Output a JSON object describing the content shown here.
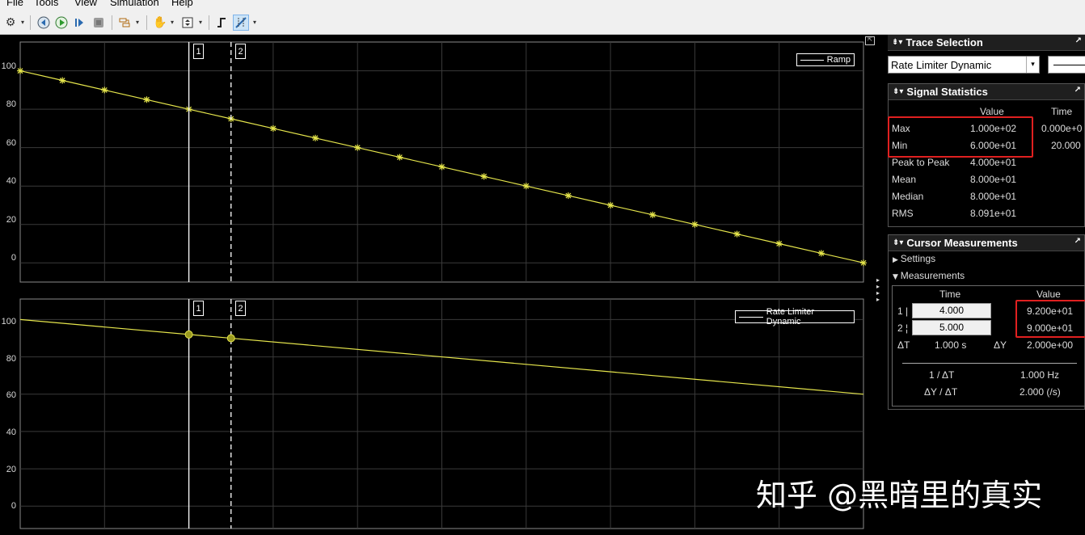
{
  "menu": [
    "File",
    "Tools",
    "View",
    "Simulation",
    "Help"
  ],
  "toolbar": {
    "icons": [
      "settings-icon",
      "rewind-icon",
      "run-icon",
      "step-forward-icon",
      "stop-icon",
      "signal-select-icon",
      "pan-icon",
      "zoom-icon",
      "trigger-icon",
      "data-cursors-icon"
    ],
    "dropdown_glyph": "▾"
  },
  "plots": [
    {
      "legend": "Ramp",
      "yticks": [
        "100",
        "80",
        "60",
        "40",
        "20",
        "0"
      ],
      "cursor_labels": [
        "1",
        "2"
      ]
    },
    {
      "legend": "Rate Limiter Dynamic",
      "yticks": [
        "100",
        "80",
        "60",
        "40",
        "20",
        "0"
      ],
      "cursor_labels": [
        "1",
        "2"
      ]
    }
  ],
  "chart_data": [
    {
      "type": "line",
      "title": "",
      "xlim": [
        0,
        20
      ],
      "ylim": [
        -10,
        115
      ],
      "grid": true,
      "legend_position": "top-right",
      "series": [
        {
          "name": "Ramp",
          "color": "#e6e64c",
          "marker": "asterisk",
          "x": [
            0,
            1,
            2,
            3,
            4,
            5,
            6,
            7,
            8,
            9,
            10,
            11,
            12,
            13,
            14,
            15,
            16,
            17,
            18,
            19,
            20
          ],
          "y": [
            100,
            95,
            90,
            85,
            80,
            75,
            70,
            65,
            60,
            55,
            50,
            45,
            40,
            35,
            30,
            25,
            20,
            15,
            10,
            5,
            0
          ]
        }
      ],
      "cursors": [
        {
          "label": "1",
          "x": 4,
          "style": "solid"
        },
        {
          "label": "2",
          "x": 5,
          "style": "dashed"
        }
      ]
    },
    {
      "type": "line",
      "title": "",
      "xlim": [
        0,
        20
      ],
      "ylim": [
        -12,
        111
      ],
      "grid": true,
      "legend_position": "top-right",
      "series": [
        {
          "name": "Rate Limiter Dynamic",
          "color": "#e6e64c",
          "x": [
            0,
            20
          ],
          "y": [
            100,
            60
          ]
        }
      ],
      "cursors": [
        {
          "label": "1",
          "x": 4,
          "y": 92,
          "style": "solid"
        },
        {
          "label": "2",
          "x": 5,
          "y": 90,
          "style": "dashed"
        }
      ]
    }
  ],
  "trace_selection": {
    "title": "Trace Selection",
    "selected": "Rate Limiter Dynamic"
  },
  "signal_statistics": {
    "title": "Signal Statistics",
    "col_value": "Value",
    "col_time": "Time",
    "rows": [
      {
        "label": "Max",
        "value": "1.000e+02",
        "time": "0.000e+0"
      },
      {
        "label": "Min",
        "value": "6.000e+01",
        "time": "20.000"
      },
      {
        "label": "Peak to Peak",
        "value": "4.000e+01",
        "time": ""
      },
      {
        "label": "Mean",
        "value": "8.000e+01",
        "time": ""
      },
      {
        "label": "Median",
        "value": "8.000e+01",
        "time": ""
      },
      {
        "label": "RMS",
        "value": "8.091e+01",
        "time": ""
      }
    ]
  },
  "cursor_measurements": {
    "title": "Cursor Measurements",
    "settings": "Settings",
    "measurements": "Measurements",
    "col_time": "Time",
    "col_value": "Value",
    "cursors": [
      {
        "label": "1",
        "time": "4.000",
        "value": "9.200e+01"
      },
      {
        "label": "2",
        "time": "5.000",
        "value": "9.000e+01"
      }
    ],
    "dt_label": "ΔT",
    "dt_value": "1.000 s",
    "dy_label": "ΔY",
    "dy_value": "2.000e+00",
    "inv_dt_label": "1 / ΔT",
    "inv_dt_value": "1.000 Hz",
    "slope_label": "ΔY / ΔT",
    "slope_value": "2.000 (/s)"
  },
  "watermark": "知乎 @黑暗里的真实",
  "colors": {
    "trace": "#e6e64c",
    "highlight": "#e02020",
    "grid": "#3a3a3a",
    "axes_bg": "#000000"
  }
}
